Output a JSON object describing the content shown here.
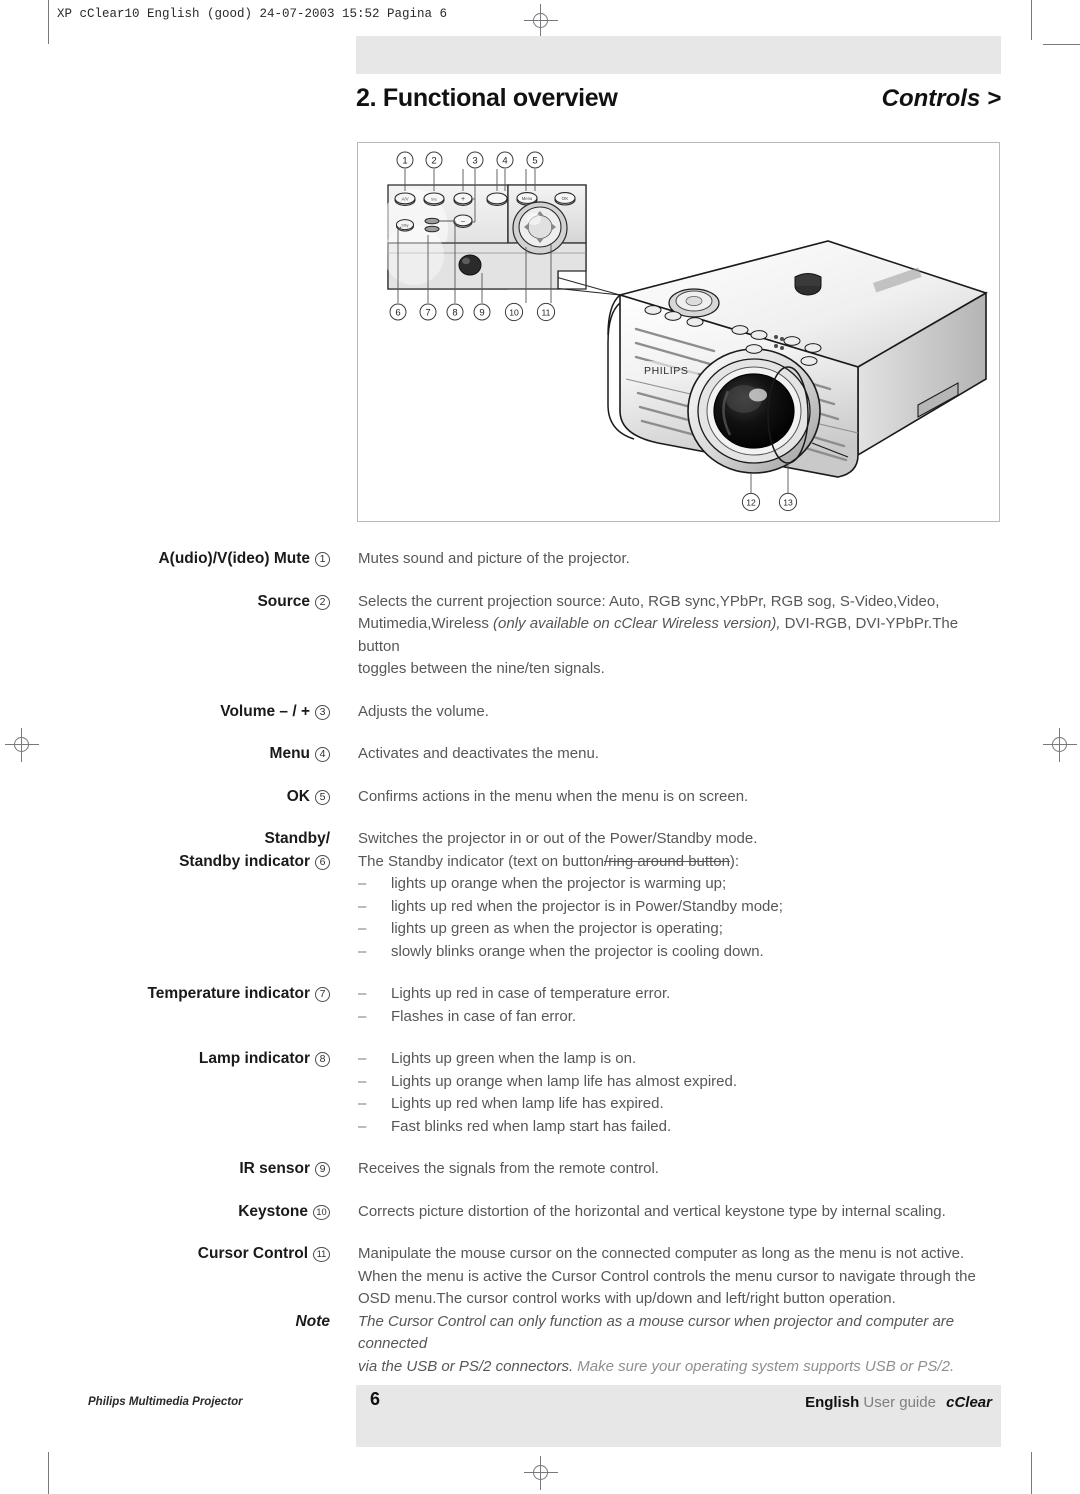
{
  "prepress": {
    "slug": "XP cClear10 English (good)  24-07-2003  15:52  Pagina 6"
  },
  "header": {
    "chapter": "2. Functional overview",
    "section": "Controls >"
  },
  "figure": {
    "brand": "PHILIPS",
    "callouts_top": [
      "1",
      "2",
      "3",
      "4",
      "5"
    ],
    "callouts_bottom": [
      "6",
      "7",
      "8",
      "9",
      "10",
      "11"
    ],
    "callouts_projector": [
      "12",
      "13"
    ]
  },
  "entries": [
    {
      "term_lines": [
        "A(udio)/V(ideo) Mute"
      ],
      "callout": "1",
      "paragraphs": [
        "Mutes sound and picture of the projector."
      ]
    },
    {
      "term_lines": [
        "Source"
      ],
      "callout": "2",
      "paragraphs": [
        "Selects the current projection source: Auto, RGB sync,YPbPr, RGB sog, S-Video,Video,",
        "Mutimedia,Wireless (only available on cClear Wireless version), DVI-RGB, DVI-YPbPr.The button",
        "toggles between the nine/ten signals."
      ],
      "italic_segment": "(only available on cClear Wireless version),"
    },
    {
      "term_lines": [
        "Volume – / +"
      ],
      "callout": "3",
      "paragraphs": [
        "Adjusts the volume."
      ]
    },
    {
      "term_lines": [
        "Menu"
      ],
      "callout": "4",
      "paragraphs": [
        "Activates and deactivates the menu."
      ]
    },
    {
      "term_lines": [
        "OK"
      ],
      "callout": "5",
      "paragraphs": [
        "Confirms actions in the menu when the menu is on screen."
      ]
    },
    {
      "term_lines": [
        "Standby/",
        "Standby indicator"
      ],
      "callout": "6",
      "paragraphs": [
        "Switches the projector in or out of the Power/Standby mode.",
        "The Standby indicator (text on button"
      ],
      "struck_text": "/ring around button",
      "paragraph_tail": "):",
      "bullets": [
        "lights up orange when the projector is warming up;",
        "lights up red when the projector is in Power/Standby mode;",
        "lights up green as when the projector is operating;",
        "slowly blinks orange when the projector is cooling down."
      ]
    },
    {
      "term_lines": [
        "Temperature indicator"
      ],
      "callout": "7",
      "bullets": [
        "Lights up red in case of temperature error.",
        "Flashes in case of fan error."
      ]
    },
    {
      "term_lines": [
        "Lamp indicator"
      ],
      "callout": "8",
      "bullets": [
        "Lights up green when the lamp is on.",
        "Lights up orange when lamp life has almost expired.",
        "Lights up red when lamp life has expired.",
        "Fast blinks red when lamp start has failed."
      ]
    },
    {
      "term_lines": [
        "IR sensor"
      ],
      "callout": "9",
      "paragraphs": [
        "Receives the signals from the remote control."
      ]
    },
    {
      "term_lines": [
        "Keystone"
      ],
      "callout": "10",
      "paragraphs": [
        "Corrects picture distortion of the horizontal and vertical keystone type by internal scaling."
      ]
    },
    {
      "term_lines": [
        "Cursor Control"
      ],
      "callout": "11",
      "paragraphs": [
        "Manipulate the mouse cursor on the connected computer as long as the menu is not active.",
        "When the menu is active the Cursor Control controls the menu cursor to navigate through the",
        "OSD menu.The cursor control works with up/down and left/right button operation."
      ]
    }
  ],
  "note": {
    "label": "Note",
    "line1": "The Cursor Control can only function as a mouse cursor when projector and computer are connected",
    "line2_strong": "via the USB or PS/2 connectors.",
    "line2_dim": " Make sure your operating system supports USB or PS/2."
  },
  "footer": {
    "left": "Philips Multimedia Projector",
    "page": "6",
    "right_strong": "English",
    "right_dim": "User guide",
    "right_brand": "cClear"
  },
  "bullet_dash": "–"
}
